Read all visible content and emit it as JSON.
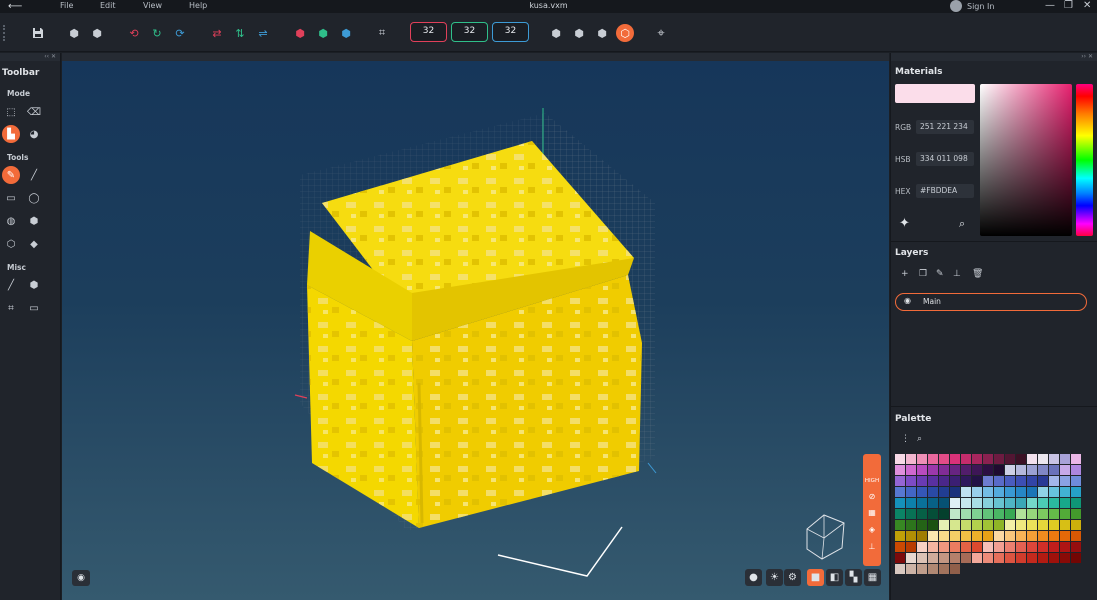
{
  "menubar": {
    "back_icon": "arrow-left-icon",
    "items": [
      "File",
      "Edit",
      "View",
      "Help"
    ],
    "title": "kusa.vxm",
    "signin": "Sign In",
    "window_controls": [
      "—",
      "❐",
      "✕"
    ]
  },
  "topbar": {
    "sizes": [
      {
        "value": "32",
        "color": "#e0405a"
      },
      {
        "value": "32",
        "color": "#2fbf8a"
      },
      {
        "value": "32",
        "color": "#3d9bd6"
      }
    ]
  },
  "left_toolbar": {
    "title": "Toolbar",
    "mode_label": "Mode",
    "tools_label": "Tools",
    "misc_label": "Misc"
  },
  "materials": {
    "title": "Materials",
    "color": "#FBDDEA",
    "rgb_label": "RGB",
    "rgb_value": "251 221 234",
    "hsb_label": "HSB",
    "hsb_value": "334 011 098",
    "hex_label": "HEX",
    "hex_value": "#FBDDEA"
  },
  "layers": {
    "title": "Layers",
    "items": [
      {
        "name": "Main",
        "visible": true,
        "selected": true
      }
    ]
  },
  "viewport": {
    "side_label": "HIGH"
  },
  "palette": {
    "title": "Palette",
    "colors": [
      [
        "#f7d9e6",
        "#f3b6cf",
        "#ee8fb6",
        "#e9679d",
        "#e24c88",
        "#d93279",
        "#c52c6c",
        "#a8265e",
        "#8a2150",
        "#6d1b41",
        "#521633",
        "#3b1125",
        "#f2e1ee",
        "#ebe6ef",
        "#c8c3e5",
        "#a8a2d8"
      ],
      [
        "#e9b6e6",
        "#df8fdc",
        "#cf68cf",
        "#b84bbf",
        "#9c38ab",
        "#802c96",
        "#672481",
        "#511d6b",
        "#3d1656",
        "#2c1042",
        "#1f0b30",
        "#cdd0e6",
        "#b4b8dc",
        "#9aa0d2",
        "#8087c6",
        "#6a72bb"
      ],
      [
        "#c6a9e8",
        "#ad86df",
        "#9565d4",
        "#7d4bc5",
        "#6a3bb4",
        "#5a30a0",
        "#4a278a",
        "#3b1f73",
        "#2e185c",
        "#221246",
        "#6e7dd0",
        "#5a6bc8",
        "#4a5cbf",
        "#3d4fb4",
        "#3244a6",
        "#283995"
      ],
      [
        "#a3b6ea",
        "#8aa2e3",
        "#6f8cdb",
        "#5778d1",
        "#4366c6",
        "#3557b8",
        "#2a4aa6",
        "#213d92",
        "#1a317c",
        "#bfe1f0",
        "#98cfeb",
        "#74bde5",
        "#54abdd",
        "#3999d3",
        "#2687c6",
        "#1b75b6"
      ],
      [
        "#8fd3e6",
        "#67c3de",
        "#42b2d4",
        "#26a1c8",
        "#1591bb",
        "#0d81ab",
        "#0a7199",
        "#086187",
        "#065173",
        "#dff0f5",
        "#c6e8ee",
        "#a8dde5",
        "#87d0db",
        "#68c3d0",
        "#4fb5c4",
        "#3ba7b6"
      ],
      [
        "#74d8c9",
        "#4ccab5",
        "#2bba9f",
        "#17a88a",
        "#0f9677",
        "#0b8466",
        "#087255",
        "#066046",
        "#054e38",
        "#04402d",
        "#bfe7c9",
        "#9fdcae",
        "#7fd093",
        "#62c37a",
        "#4ab665",
        "#38a853"
      ],
      [
        "#b2e29a",
        "#97d67c",
        "#7dc960",
        "#65bb49",
        "#52ab38",
        "#439a2c",
        "#378823",
        "#2d751c",
        "#246316",
        "#1b5110",
        "#e6f0b4",
        "#d6e78e",
        "#c5dc6b",
        "#b3d04d",
        "#a1c336",
        "#8fb526"
      ],
      [
        "#f3f0a6",
        "#efe97f",
        "#ebe15a",
        "#e5d73b",
        "#dfcc23",
        "#d7bf15",
        "#cdb00c",
        "#c0a007",
        "#b18f04",
        "#a07d02",
        "#fbe7b0",
        "#f8db8a",
        "#f5ce66",
        "#f1c045",
        "#ecb12a",
        "#e6a117"
      ],
      [
        "#fbd9a3",
        "#f9c77c",
        "#f7b457",
        "#f4a037",
        "#f08c1f",
        "#eb7910",
        "#e36808",
        "#d85804",
        "#ca4902",
        "#b83c01",
        "#f8d1c4",
        "#f4b5a1",
        "#ef987f",
        "#ea7c60",
        "#e46245",
        "#dc4a2f"
      ],
      [
        "#f6bfb7",
        "#f19f93",
        "#eb7f70",
        "#e46152",
        "#dc463a",
        "#d12f28",
        "#c21e1c",
        "#ae1414",
        "#960e0f",
        "#7d0a0b",
        "#e7d7cf",
        "#dcc2b5",
        "#d0ac9b",
        "#c39682",
        "#b5806b",
        "#a66b57"
      ],
      [
        "#f2a89a",
        "#ec8b79",
        "#e56f5b",
        "#dc5441",
        "#d13c2c",
        "#c4291d",
        "#b31b12",
        "#9f110b",
        "#890a07",
        "#730604",
        "#d9c9c1",
        "#ccb3a6",
        "#bf9d8b",
        "#b08873",
        "#a1735d",
        "#905f4a"
      ]
    ]
  }
}
